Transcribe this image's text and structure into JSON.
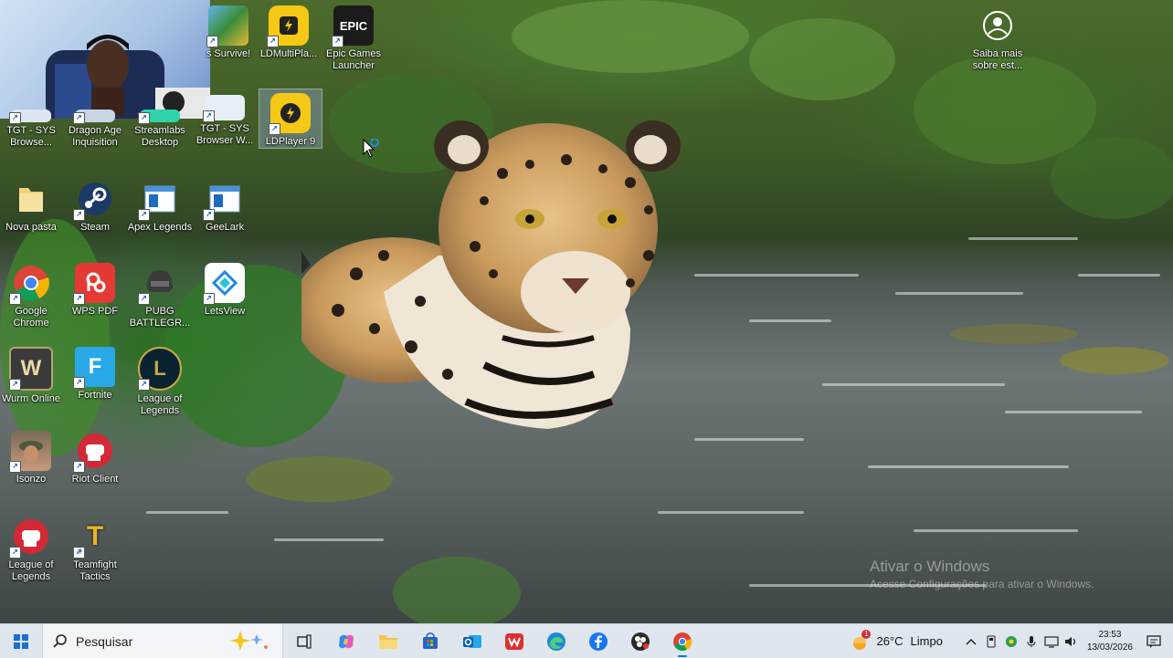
{
  "desktop": {
    "icons": [
      {
        "id": "survive",
        "label": "s Survive!"
      },
      {
        "id": "ldmulti",
        "label": "LDMultiPla..."
      },
      {
        "id": "epic",
        "label": "Epic Games Launcher",
        "glyph": "EPIC"
      },
      {
        "id": "saiba",
        "label": "Saiba mais sobre est..."
      },
      {
        "id": "tgt1",
        "label": "TGT - SYS Browse..."
      },
      {
        "id": "dragon",
        "label": "Dragon Age Inquisition"
      },
      {
        "id": "streamlabs",
        "label": "Streamlabs Desktop"
      },
      {
        "id": "tgt2",
        "label": "TGT - SYS Browser W..."
      },
      {
        "id": "ldplayer",
        "label": "LDPlayer 9"
      },
      {
        "id": "novapasta",
        "label": "Nova pasta"
      },
      {
        "id": "steam",
        "label": "Steam"
      },
      {
        "id": "apex",
        "label": "Apex Legends"
      },
      {
        "id": "geelark",
        "label": "GeeLark"
      },
      {
        "id": "chrome",
        "label": "Google Chrome"
      },
      {
        "id": "wps",
        "label": "WPS PDF"
      },
      {
        "id": "pubg",
        "label": "PUBG BATTLEGR..."
      },
      {
        "id": "letsview",
        "label": "LetsView"
      },
      {
        "id": "wurm",
        "label": "Wurm Online",
        "glyph": "W"
      },
      {
        "id": "fortnite",
        "label": "Fortnite",
        "glyph": "F"
      },
      {
        "id": "lol1",
        "label": "League of Legends",
        "glyph": "L"
      },
      {
        "id": "isonzo",
        "label": "Isonzo"
      },
      {
        "id": "riot",
        "label": "Riot Client"
      },
      {
        "id": "lol2",
        "label": "League of Legends"
      },
      {
        "id": "tft",
        "label": "Teamfight Tactics",
        "glyph": "T"
      }
    ]
  },
  "watermark": {
    "title": "Ativar o Windows",
    "subtitle": "Acesse Configurações para ativar o Windows."
  },
  "taskbar": {
    "search_placeholder": "Pesquisar",
    "weather_temp": "26°C",
    "weather_desc": "Limpo",
    "weather_alert": "1",
    "time": "23:53",
    "date": "13/03/2026"
  },
  "colors": {
    "taskbar_bg": "#dfe6ee",
    "accent": "#0078d4"
  }
}
